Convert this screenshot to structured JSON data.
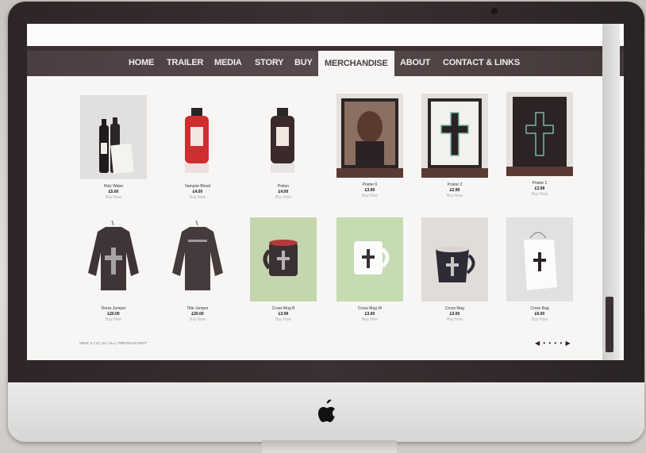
{
  "nav": {
    "items": [
      "HOME",
      "TRAILER",
      "MEDIA",
      "STORY",
      "BUY",
      "MERCHANDISE",
      "ABOUT",
      "CONTACT & LINKS"
    ],
    "active": "MERCHANDISE"
  },
  "products": [
    {
      "name": "Holy Water",
      "price": "£5.00",
      "buy": "Buy Now"
    },
    {
      "name": "Vampire Blood",
      "price": "£4.00",
      "buy": "Buy Now"
    },
    {
      "name": "Potion",
      "price": "£4.00",
      "buy": "Buy Now"
    },
    {
      "name": "Poster 6",
      "price": "£3.99",
      "buy": "Buy Now"
    },
    {
      "name": "Poster 2",
      "price": "£2.99",
      "buy": "Buy Now"
    },
    {
      "name": "Poster 1",
      "price": "£3.99",
      "buy": "Buy Now"
    },
    {
      "name": "Dress Jumper",
      "price": "£20.00",
      "buy": "Buy Now"
    },
    {
      "name": "Title Jumper",
      "price": "£20.00",
      "buy": "Buy Now"
    },
    {
      "name": "Cross Mug B",
      "price": "£3.99",
      "buy": "Buy Now"
    },
    {
      "name": "Cross Mug W",
      "price": "£3.00",
      "buy": "Buy Now"
    },
    {
      "name": "Cross Mug",
      "price": "£3.00",
      "buy": "Buy Now"
    },
    {
      "name": "Cross Bag",
      "price": "£6.00",
      "buy": "Buy Now"
    }
  ],
  "footer": {
    "text": "VIEW: 6 | 12 | 24 | ALL | PREVIOUS NEXT"
  },
  "pager": {
    "text": "◀ • • • • ▶"
  },
  "colors": {
    "nav_bg": "#4a3e40",
    "accent": "#f7f6f4",
    "screen_bg": "#f7f6f4"
  }
}
